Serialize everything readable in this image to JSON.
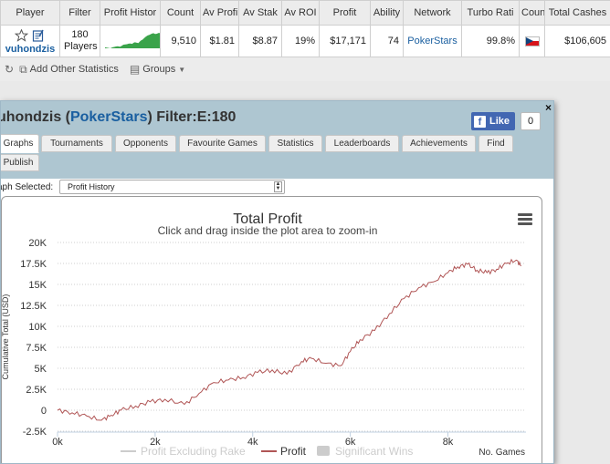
{
  "stats_table": {
    "headers": [
      "Player",
      "Filter",
      "Profit Histor",
      "Count",
      "Av Profi",
      "Av Stak",
      "Av ROI",
      "Profit",
      "Ability",
      "Network",
      "Turbo Rati",
      "Coun",
      "Total Cashes"
    ],
    "row": {
      "player": "vuhondzis",
      "filter_line1": "180",
      "filter_line2": "Players",
      "count": "9,510",
      "av_profit": "$1.81",
      "av_stake": "$8.87",
      "av_roi": "19%",
      "profit": "$17,171",
      "ability": "74",
      "network": "PokerStars",
      "turbo_ratio": "99.8%",
      "country_flag": "czech-flag",
      "total_cashes": "$106,605"
    },
    "sparkline_color": "#3aa34a"
  },
  "toolbar": {
    "add_stats_label": "Add Other Statistics",
    "groups_label": "Groups"
  },
  "dialog": {
    "title_prefix": "uhondzis (",
    "network": "PokerStars",
    "title_suffix": ") Filter:E:180",
    "like_label": "Like",
    "like_count": "0",
    "close_symbol": "×",
    "tabs": [
      "Graphs",
      "Tournaments",
      "Opponents",
      "Favourite Games",
      "Statistics",
      "Leaderboards",
      "Achievements",
      "Find",
      "Publish"
    ],
    "active_tab": "Graphs",
    "graph_selected_label": "aph Selected:",
    "graph_selected_value": "Profit History"
  },
  "chart_data": {
    "type": "line",
    "title": "Total Profit",
    "subtitle": "Click and drag inside the plot area to zoom-in",
    "ylabel": "Cumulative Total (USD)",
    "xlabel": "No. Games",
    "ylim": [
      -2500,
      20000
    ],
    "xlim": [
      0,
      9600
    ],
    "y_ticks": [
      "20K",
      "17.5K",
      "15K",
      "12.5K",
      "10K",
      "7.5K",
      "5K",
      "2.5K",
      "0",
      "-2.5K"
    ],
    "y_tick_values": [
      20000,
      17500,
      15000,
      12500,
      10000,
      7500,
      5000,
      2500,
      0,
      -2500
    ],
    "x_ticks": [
      "0k",
      "2k",
      "4k",
      "6k",
      "8k"
    ],
    "x_tick_values": [
      0,
      2000,
      4000,
      6000,
      8000
    ],
    "legend": [
      "Profit Excluding Rake",
      "Profit",
      "Significant Wins"
    ],
    "legend_active": "Profit",
    "series": [
      {
        "name": "Profit",
        "color": "#b05555",
        "x": [
          0,
          300,
          600,
          900,
          1100,
          1300,
          1600,
          1900,
          2200,
          2600,
          2900,
          3200,
          3500,
          3800,
          4100,
          4400,
          4700,
          5000,
          5200,
          5500,
          5800,
          6000,
          6200,
          6500,
          6800,
          7100,
          7400,
          7700,
          8000,
          8200,
          8400,
          8600,
          8800,
          9000,
          9200,
          9400,
          9500
        ],
        "values": [
          0,
          -300,
          -700,
          -1200,
          -600,
          0,
          500,
          1000,
          1300,
          700,
          2000,
          3300,
          3600,
          3900,
          4500,
          4800,
          4300,
          5800,
          6200,
          5600,
          5300,
          7000,
          8400,
          9500,
          11500,
          13300,
          14600,
          15300,
          16400,
          17100,
          17400,
          16700,
          16400,
          16800,
          17500,
          17900,
          17200
        ]
      }
    ],
    "grid": "horizontal dotted"
  }
}
